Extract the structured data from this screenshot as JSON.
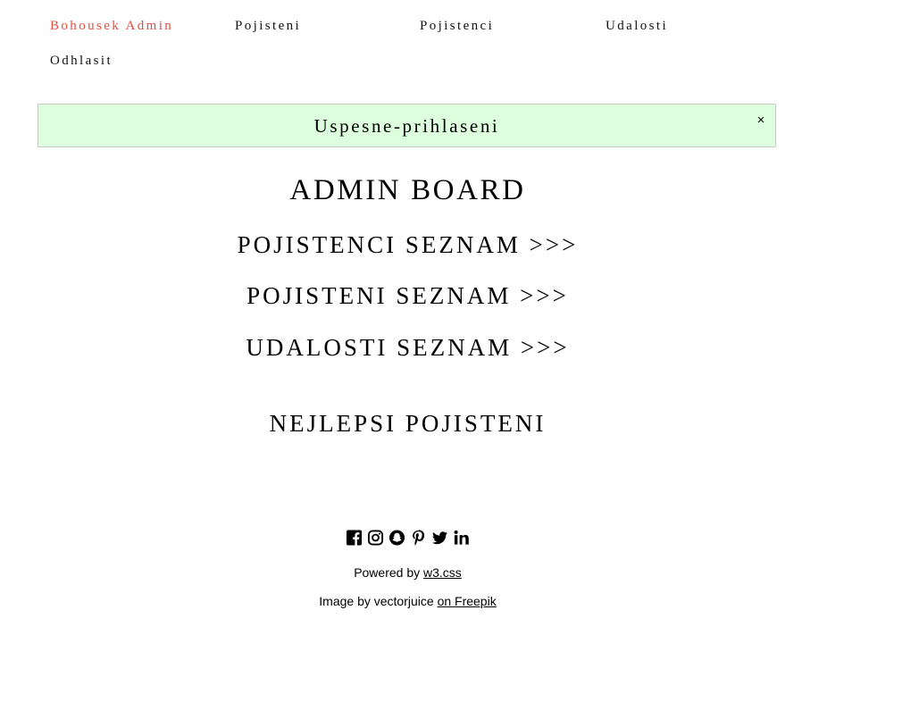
{
  "nav": {
    "brand": "Bohousek Admin",
    "items": [
      "Pojisteni",
      "Pojistenci",
      "Udalosti"
    ],
    "logout": "Odhlasit"
  },
  "alert": {
    "message": "Uspesne-prihlaseni",
    "close": "×"
  },
  "main": {
    "title": "ADMIN BOARD",
    "links": [
      "POJISTENCI SEZNAM >>>",
      "POJISTENI SEZNAM >>>",
      "UDALOSTI SEZNAM >>>"
    ],
    "best_heading": "NEJLEPSI POJISTENI"
  },
  "footer": {
    "social_icons": [
      "facebook-icon",
      "instagram-icon",
      "snapchat-icon",
      "pinterest-icon",
      "twitter-icon",
      "linkedin-icon"
    ],
    "powered_prefix": "Powered by",
    "powered_link": "w3.css",
    "image_prefix": "Image by vectorjuice",
    "image_link": "on Freepik"
  },
  "colors": {
    "brand": "#e74c3c",
    "alert_bg": "#ddffdd"
  }
}
